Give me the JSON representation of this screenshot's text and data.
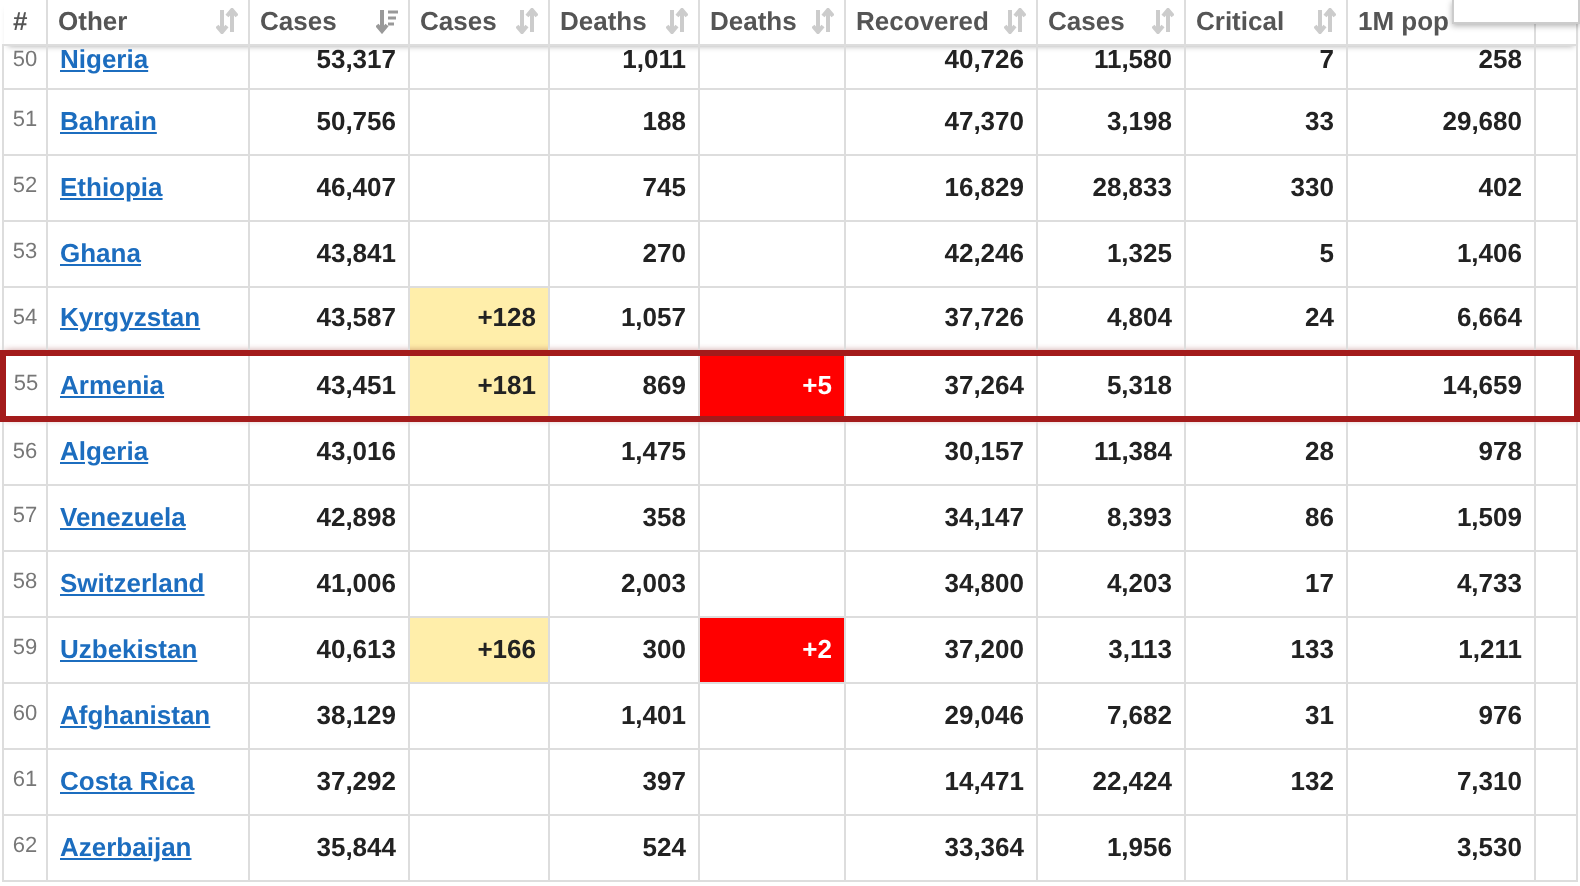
{
  "table": {
    "columns": [
      {
        "label": "#",
        "sortable": false
      },
      {
        "label": "Other",
        "sortable": true,
        "sorted": false
      },
      {
        "label": "Cases",
        "sortable": true,
        "sorted": true
      },
      {
        "label": "Cases",
        "sortable": true,
        "sorted": false
      },
      {
        "label": "Deaths",
        "sortable": true,
        "sorted": false
      },
      {
        "label": "Deaths",
        "sortable": true,
        "sorted": false
      },
      {
        "label": "Recovered",
        "sortable": true,
        "sorted": false
      },
      {
        "label": "Cases",
        "sortable": true,
        "sorted": false
      },
      {
        "label": "Critical",
        "sortable": true,
        "sorted": false
      },
      {
        "label": "1M pop",
        "sortable": false
      }
    ],
    "rows": [
      {
        "rank": "50",
        "country": "Nigeria",
        "cases": "53,317",
        "deaths": "1,011",
        "recovered": "40,726",
        "active": "11,580",
        "critical": "7",
        "per_million": "258",
        "highlighted": false,
        "partial": true
      },
      {
        "rank": "51",
        "country": "Bahrain",
        "cases": "50,756",
        "deaths": "188",
        "recovered": "47,370",
        "active": "3,198",
        "critical": "33",
        "per_million": "29,680",
        "highlighted": false
      },
      {
        "rank": "52",
        "country": "Ethiopia",
        "cases": "46,407",
        "deaths": "745",
        "recovered": "16,829",
        "active": "28,833",
        "critical": "330",
        "per_million": "402",
        "highlighted": false
      },
      {
        "rank": "53",
        "country": "Ghana",
        "cases": "43,841",
        "deaths": "270",
        "recovered": "42,246",
        "active": "1,325",
        "critical": "5",
        "per_million": "1,406",
        "highlighted": false
      },
      {
        "rank": "54",
        "country": "Kyrgyzstan",
        "cases": "43,587",
        "new_cases": "+128",
        "deaths": "1,057",
        "recovered": "37,726",
        "active": "4,804",
        "critical": "24",
        "per_million": "6,664",
        "highlighted": false
      },
      {
        "rank": "55",
        "country": "Armenia",
        "cases": "43,451",
        "new_cases": "+181",
        "deaths": "869",
        "new_deaths": "+5",
        "recovered": "37,264",
        "active": "5,318",
        "per_million": "14,659",
        "highlighted": true
      },
      {
        "rank": "56",
        "country": "Algeria",
        "cases": "43,016",
        "deaths": "1,475",
        "recovered": "30,157",
        "active": "11,384",
        "critical": "28",
        "per_million": "978",
        "highlighted": false
      },
      {
        "rank": "57",
        "country": "Venezuela",
        "cases": "42,898",
        "deaths": "358",
        "recovered": "34,147",
        "active": "8,393",
        "critical": "86",
        "per_million": "1,509",
        "highlighted": false
      },
      {
        "rank": "58",
        "country": "Switzerland",
        "cases": "41,006",
        "deaths": "2,003",
        "recovered": "34,800",
        "active": "4,203",
        "critical": "17",
        "per_million": "4,733",
        "highlighted": false
      },
      {
        "rank": "59",
        "country": "Uzbekistan",
        "cases": "40,613",
        "new_cases": "+166",
        "deaths": "300",
        "new_deaths": "+2",
        "recovered": "37,200",
        "active": "3,113",
        "critical": "133",
        "per_million": "1,211",
        "highlighted": false
      },
      {
        "rank": "60",
        "country": "Afghanistan",
        "cases": "38,129",
        "deaths": "1,401",
        "recovered": "29,046",
        "active": "7,682",
        "critical": "31",
        "per_million": "976",
        "highlighted": false
      },
      {
        "rank": "61",
        "country": "Costa Rica",
        "cases": "37,292",
        "deaths": "397",
        "recovered": "14,471",
        "active": "22,424",
        "critical": "132",
        "per_million": "7,310",
        "highlighted": false
      },
      {
        "rank": "62",
        "country": "Azerbaijan",
        "cases": "35,844",
        "deaths": "524",
        "recovered": "33,364",
        "active": "1,956",
        "per_million": "3,530",
        "highlighted": false
      }
    ]
  }
}
